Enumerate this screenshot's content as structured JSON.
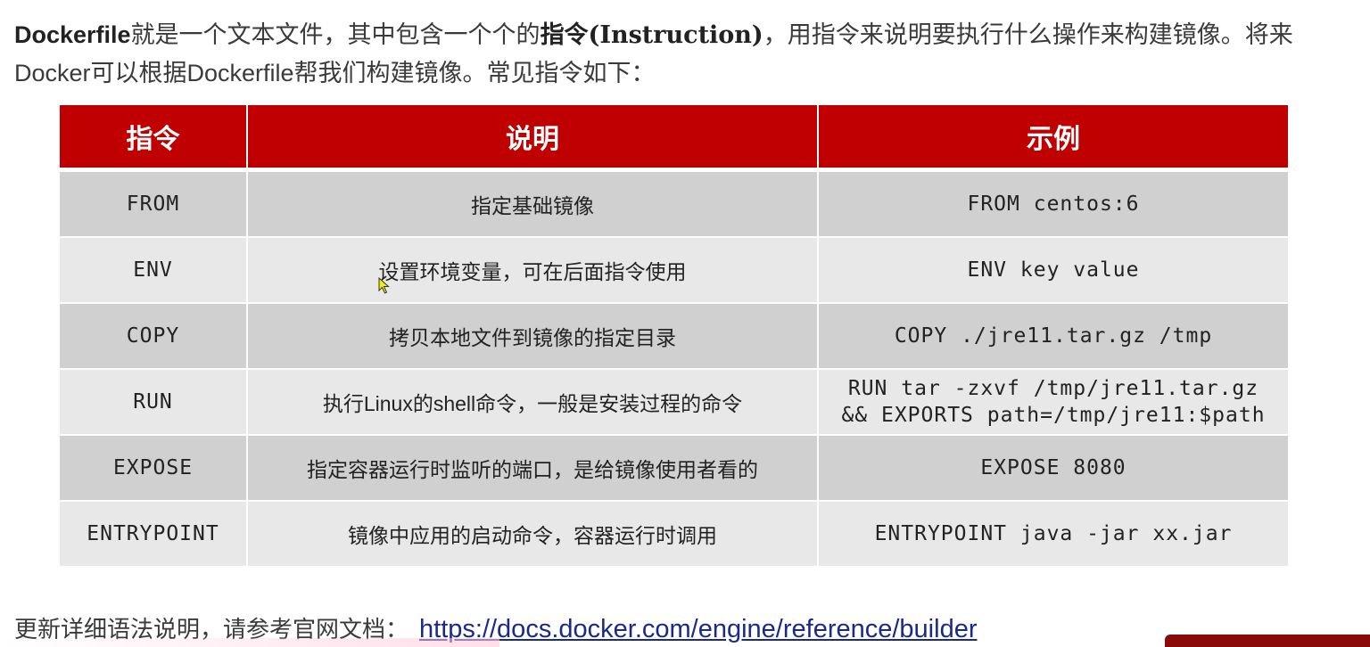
{
  "intro": {
    "word_dockerfile": "Dockerfile",
    "part1": "就是一个文本文件，其中包含一个个的",
    "word_instruction": "指令(Instruction)",
    "part2": "，用指令来说明要执行什么操作来构建镜像。将来Docker可以根据Dockerfile帮我们构建镜像。常见指令如下："
  },
  "table": {
    "headers": [
      "指令",
      "说明",
      "示例"
    ],
    "rows": [
      {
        "instruction": "FROM",
        "description": "指定基础镜像",
        "example": "FROM centos:6"
      },
      {
        "instruction": "ENV",
        "description": "设置环境变量，可在后面指令使用",
        "example": "ENV key value"
      },
      {
        "instruction": "COPY",
        "description": "拷贝本地文件到镜像的指定目录",
        "example": "COPY ./jre11.tar.gz /tmp"
      },
      {
        "instruction": "RUN",
        "description": "执行Linux的shell命令，一般是安装过程的命令",
        "example_line1": "RUN tar -zxvf /tmp/jre11.tar.gz",
        "example_line2": "&& EXPORTS path=/tmp/jre11:$path"
      },
      {
        "instruction": "EXPOSE",
        "description": "指定容器运行时监听的端口，是给镜像使用者看的",
        "example": "EXPOSE 8080"
      },
      {
        "instruction": "ENTRYPOINT",
        "description": "镜像中应用的启动命令，容器运行时调用",
        "example": "ENTRYPOINT java -jar xx.jar"
      }
    ]
  },
  "footer": {
    "text": "更新详细语法说明，请参考官网文档：",
    "link": "https://docs.docker.com/engine/reference/builder"
  },
  "colors": {
    "header_bg": "#c00000",
    "row_dark": "#d0d0d0",
    "row_light": "#e8e8e8",
    "link": "#1a2a8a"
  },
  "icons": {
    "cursor": "mouse-pointer-icon"
  }
}
